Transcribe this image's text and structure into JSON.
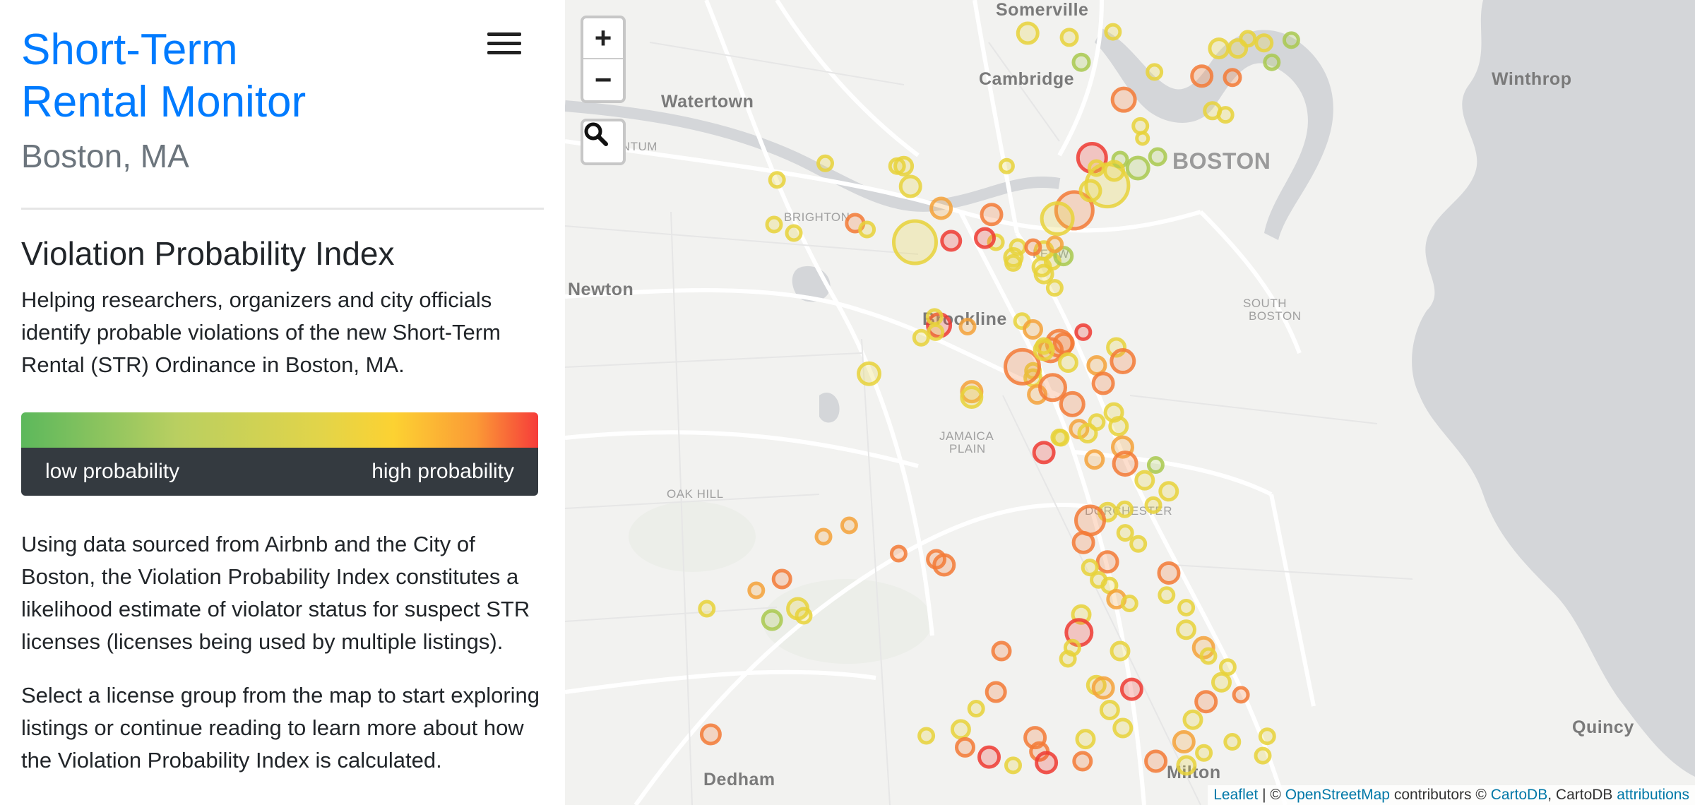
{
  "header": {
    "title_line1": "Short-Term",
    "title_line2": "Rental Monitor",
    "city": "Boston, MA"
  },
  "menu_icon": "hamburger-menu-icon",
  "index_section": {
    "heading": "Violation Probability Index",
    "intro": "Helping researchers, organizers and city officials identify probable violations of the new Short-Term Rental (STR) Ordinance in Boston, MA.",
    "legend": {
      "low_label": "low probability",
      "high_label": "high probability",
      "colors": [
        "#5cb85c",
        "#b9cf61",
        "#e2d449",
        "#fcd232",
        "#fb9a36",
        "#f63c3a"
      ]
    },
    "paragraph1": "Using data sourced from Airbnb and the City of Boston, the Violation Probability Index constitutes a likelihood estimate of violator status for suspect STR licenses (licenses being used by multiple listings).",
    "paragraph2": "Select a license group from the map to start exploring listings or continue reading to learn more about how the Violation Probability Index is calculated."
  },
  "map": {
    "zoom_in_label": "+",
    "zoom_out_label": "−",
    "search_icon": "search-icon",
    "places": [
      {
        "name": "Somerville",
        "kind": "big"
      },
      {
        "name": "Cambridge",
        "kind": "big"
      },
      {
        "name": "Watertown",
        "kind": "big"
      },
      {
        "name": "Winthrop",
        "kind": "big"
      },
      {
        "name": "BOSTON",
        "kind": "xl"
      },
      {
        "name": "ANTUM",
        "kind": "sm"
      },
      {
        "name": "BRIGHTON",
        "kind": "sm"
      },
      {
        "name": "Newton",
        "kind": "big"
      },
      {
        "name": "Brookline",
        "kind": "big"
      },
      {
        "name": "FENW",
        "kind": "sm"
      },
      {
        "name": "SOUTH",
        "kind": "sm"
      },
      {
        "name": "BOSTON",
        "kind": "sm"
      },
      {
        "name": "JAMAICA",
        "kind": "sm"
      },
      {
        "name": "PLAIN",
        "kind": "sm"
      },
      {
        "name": "OAK HILL",
        "kind": "sm"
      },
      {
        "name": "DORCHESTER",
        "kind": "sm"
      },
      {
        "name": "Quincy",
        "kind": "big"
      },
      {
        "name": "Dedham",
        "kind": "big"
      },
      {
        "name": "Milton",
        "kind": "big"
      }
    ],
    "attribution": {
      "leaflet": "Leaflet",
      "sep1": " | © ",
      "osm": "OpenStreetMap",
      "mid": " contributors © ",
      "cartodb": "CartoDB",
      "sep2": ", CartoDB ",
      "attributions": "attributions"
    }
  }
}
